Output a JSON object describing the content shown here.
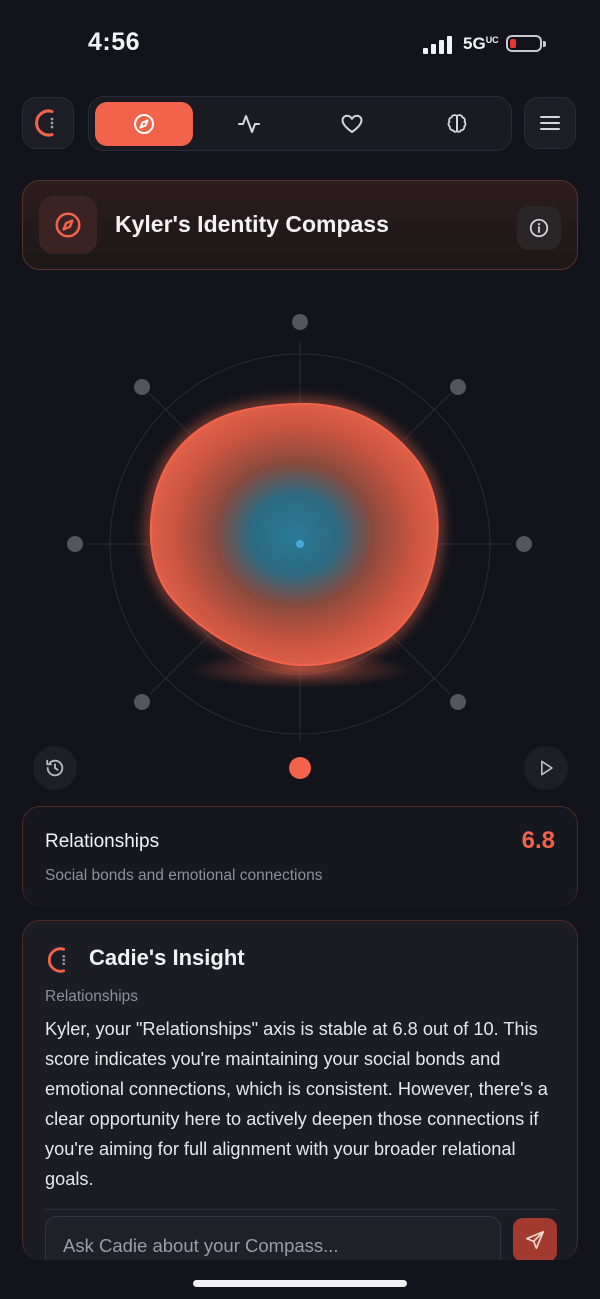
{
  "status_bar": {
    "time": "4:56",
    "network": "5G",
    "network_suffix": "UC",
    "battery_level": 0.15
  },
  "nav": {
    "tabs": [
      {
        "icon": "compass-icon",
        "active": true
      },
      {
        "icon": "activity-icon",
        "active": false
      },
      {
        "icon": "heart-icon",
        "active": false
      },
      {
        "icon": "brain-icon",
        "active": false
      }
    ],
    "menu_icon": "hamburger-icon",
    "logo_icon": "cadie-logo-icon"
  },
  "header": {
    "title": "Kyler's Identity Compass",
    "icon": "compass-icon",
    "info_icon": "info-icon"
  },
  "compass": {
    "axis_count": 8,
    "selected_axis_index": 4,
    "accent_color": "#f3624a",
    "history_icon": "history-icon",
    "play_icon": "play-icon"
  },
  "axis_detail": {
    "name": "Relationships",
    "score": "6.8",
    "description": "Social bonds and emotional connections"
  },
  "insight": {
    "title": "Cadie's Insight",
    "category": "Relationships",
    "body": "Kyler, your \"Relationships\" axis is stable at 6.8 out of 10. This score indicates you're maintaining your social bonds and emotional connections, which is consistent. However, there's a clear opportunity here to actively deepen those connections if you're aiming for full alignment with your broader relational goals.",
    "input_placeholder": "Ask Cadie about your Compass...",
    "send_icon": "send-icon"
  },
  "colors": {
    "background": "#13141b",
    "accent": "#f3624a",
    "teal_center": "#2c6f8a"
  }
}
